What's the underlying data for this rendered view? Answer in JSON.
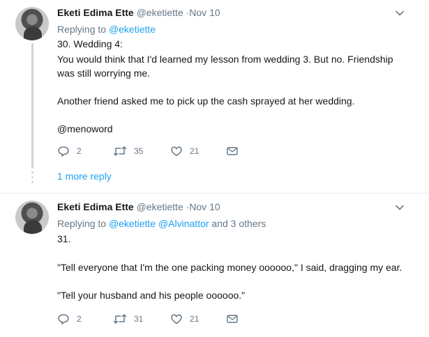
{
  "tweets": [
    {
      "name": "Eketi Edima Ette",
      "handle": "@eketiette",
      "time": "·Nov 10",
      "replying_prefix": "Replying to ",
      "replying_to": "@eketiette",
      "lines": [
        "30. Wedding 4:",
        "You would think that I'd learned my lesson from wedding 3. But no. Friendship",
        "was still worrying me.",
        "Another friend asked me to pick up the cash sprayed at her wedding."
      ],
      "mention": "@menoword",
      "replies": "2",
      "retweets": "35",
      "likes": "21",
      "more_reply": "1 more reply"
    },
    {
      "name": "Eketi Edima Ette",
      "handle": "@eketiette",
      "time": "·Nov 10",
      "replying_prefix": "Replying to ",
      "replying_to": "@eketiette @Alvinattor",
      "replying_suffix": " and 3 others",
      "lines": [
        "31.",
        "\"Tell everyone that I'm the one packing money oooooo,\" I said, dragging my ear.",
        "\"Tell your husband and his people oooooo.\""
      ],
      "replies": "2",
      "retweets": "31",
      "likes": "21"
    }
  ],
  "icons": {
    "reply": "reply-icon",
    "retweet": "retweet-icon",
    "like": "heart-icon",
    "dm": "envelope-icon",
    "menu": "chevron-down-icon"
  },
  "colors": {
    "link": "#1da1f2",
    "secondary_text": "#657786",
    "thread_line": "#cad5de",
    "divider": "#e6ecf0"
  }
}
